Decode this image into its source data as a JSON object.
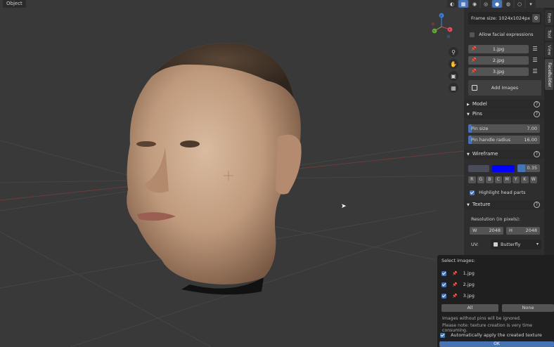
{
  "header": {
    "mode_label": "Object",
    "icons": [
      "view-icon",
      "overlay-icon",
      "gizmo-icon",
      "wireframe-shading-icon",
      "solid-shading-icon",
      "material-shading-icon",
      "rendered-shading-icon",
      "dropdown-icon"
    ]
  },
  "gizmo": {
    "x": "X",
    "y": "Y",
    "z": "Z"
  },
  "tabs": [
    {
      "label": "Item"
    },
    {
      "label": "Tool"
    },
    {
      "label": "View"
    },
    {
      "label": "FaceBuilder"
    }
  ],
  "panel": {
    "frame_size": "Frame size: 1024x1024px",
    "allow_expressions_label": "Allow facial expressions",
    "images": [
      {
        "name": "1.jpg"
      },
      {
        "name": "2.jpg"
      },
      {
        "name": "3.jpg"
      }
    ],
    "add_images_label": "Add Images",
    "sections": {
      "model": "Model",
      "pins": "Pins",
      "wireframe": "Wireframe",
      "texture": "Texture"
    },
    "pin_size": {
      "label": "Pin size",
      "value": "7.00"
    },
    "pin_handle_radius": {
      "label": "Pin handle radius",
      "value": "16.00"
    },
    "wireframe": {
      "color1": "#4a4c59",
      "color2": "#0000ff",
      "opacity_value": "0.35",
      "opacity_fraction": 0.35,
      "letters": [
        "R",
        "G",
        "B",
        "C",
        "M",
        "Y",
        "K",
        "W"
      ],
      "highlight_label": "Highlight head parts"
    },
    "texture": {
      "resolution_label": "Resolution (in pixels):",
      "width_label": "W",
      "width_value": "2048",
      "height_label": "H",
      "height_value": "2048",
      "uv_label": "UV:",
      "uv_value": "Butterfly"
    }
  },
  "popup": {
    "title": "Select images:",
    "images": [
      {
        "name": "1.jpg"
      },
      {
        "name": "2.jpg"
      },
      {
        "name": "3.jpg"
      }
    ],
    "all_label": "All",
    "none_label": "None",
    "note1": "Images without pins will be ignored.",
    "note2": "Please note: texture creation is very time consuming.",
    "auto_apply_label": "Automatically apply the created texture",
    "ok_label": "OK"
  }
}
